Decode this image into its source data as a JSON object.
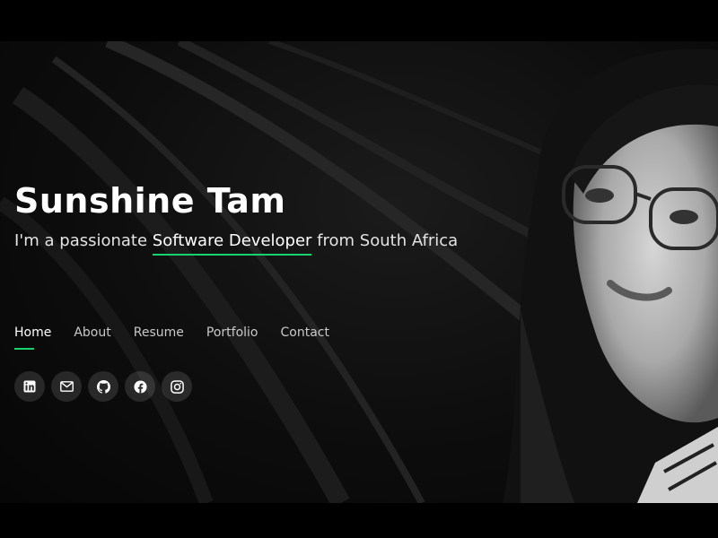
{
  "profile": {
    "name": "Sunshine Tam",
    "tagline_prefix": "I'm a passionate ",
    "tagline_highlight": "Software Developer",
    "tagline_suffix": " from South Africa"
  },
  "nav": {
    "items": [
      "Home",
      "About",
      "Resume",
      "Portfolio",
      "Contact"
    ],
    "active": "Home"
  },
  "social": {
    "icons": [
      "linkedin-icon",
      "mail-icon",
      "github-icon",
      "facebook-icon",
      "instagram-icon"
    ]
  },
  "colors": {
    "accent": "#18d26e",
    "background": "#0d0d0d",
    "text": "#ffffff"
  }
}
